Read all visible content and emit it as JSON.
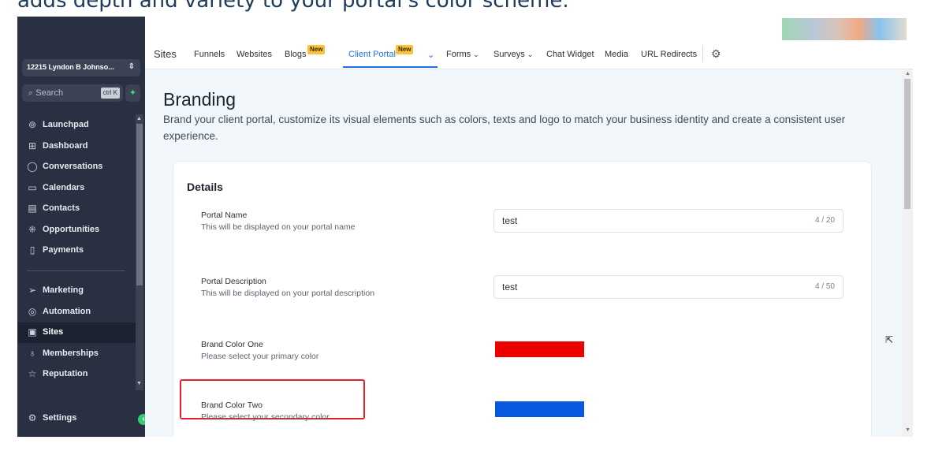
{
  "caption": "adds depth and variety to your portal's color scheme.",
  "sidebar": {
    "location": "12215 Lyndon B Johnso...",
    "search_placeholder": "Search",
    "search_shortcut": "ctrl K",
    "items": [
      {
        "label": "Launchpad",
        "icon": "rocket-icon"
      },
      {
        "label": "Dashboard",
        "icon": "grid-icon"
      },
      {
        "label": "Conversations",
        "icon": "chat-icon"
      },
      {
        "label": "Calendars",
        "icon": "calendar-icon"
      },
      {
        "label": "Contacts",
        "icon": "contacts-icon"
      },
      {
        "label": "Opportunities",
        "icon": "opportunities-icon"
      },
      {
        "label": "Payments",
        "icon": "payments-icon"
      },
      {
        "label": "Marketing",
        "icon": "send-icon"
      },
      {
        "label": "Automation",
        "icon": "automation-icon"
      },
      {
        "label": "Sites",
        "icon": "sites-icon",
        "active": true
      },
      {
        "label": "Memberships",
        "icon": "badge-icon"
      },
      {
        "label": "Reputation",
        "icon": "star-icon"
      },
      {
        "label": "Settings",
        "icon": "gear-icon"
      }
    ]
  },
  "topnav": {
    "section": "Sites",
    "tabs": [
      {
        "label": "Funnels"
      },
      {
        "label": "Websites"
      },
      {
        "label": "Blogs",
        "badge": "New"
      },
      {
        "label": "Client Portal",
        "badge": "New",
        "active": true
      },
      {
        "label": "Forms"
      },
      {
        "label": "Surveys"
      },
      {
        "label": "Chat Widget"
      },
      {
        "label": "Media"
      },
      {
        "label": "URL Redirects"
      }
    ]
  },
  "page": {
    "title": "Branding",
    "subtitle": "Brand your client portal, customize its visual elements such as colors, texts and logo to match your business identity and create a consistent user experience."
  },
  "details": {
    "title": "Details",
    "portal_name": {
      "label": "Portal Name",
      "help": "This will be displayed on your portal name",
      "value": "test",
      "count": "4 / 20"
    },
    "portal_description": {
      "label": "Portal Description",
      "help": "This will be displayed on your portal description",
      "value": "test",
      "count": "4 / 50"
    },
    "brand_color_one": {
      "label": "Brand Color One",
      "help": "Please select your primary color",
      "color": "#ee0000"
    },
    "brand_color_two": {
      "label": "Brand Color Two",
      "help": "Please select your secondary color",
      "color": "#0a58e0"
    }
  },
  "colors": {
    "accent": "#1e73e6",
    "sidebar_bg": "#283042",
    "badge": "#f8c33c",
    "highlight": "#e5202c"
  }
}
